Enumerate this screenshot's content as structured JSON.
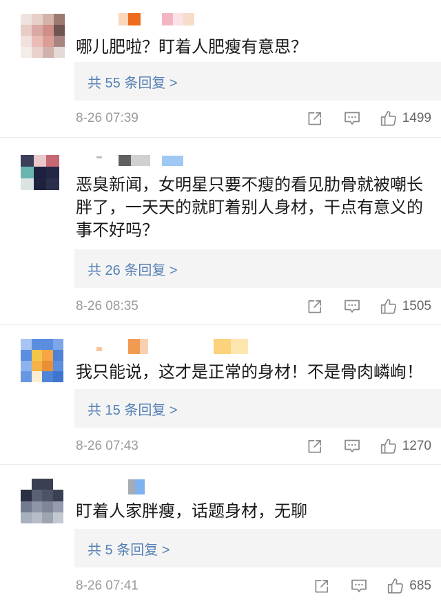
{
  "comments": [
    {
      "avatar_colors": [
        [
          "#efe3df",
          "#e6d0c9",
          "#d4b3aa",
          "#9d7a70"
        ],
        [
          "#e7cdc5",
          "#d9aaa3",
          "#cf8f88",
          "#6f5650"
        ],
        [
          "#f1e0dc",
          "#e9bcb6",
          "#dd9d97",
          "#a78680"
        ],
        [
          "#f4ece9",
          "#e9d2cc",
          "#d1b1ab",
          "#e3dad7"
        ]
      ],
      "text": "哪儿肥啦？盯着人肥瘦有意思？",
      "replies_label": "共 55 条回复 >",
      "time": "8-26 07:39",
      "likes": "1499"
    },
    {
      "avatar_colors": [
        [
          "#3b3f5a",
          "#e9c9cc",
          "#c76774"
        ],
        [
          "#6bb5b0",
          "#1c2140",
          "#222743"
        ],
        [
          "#dbe3e3",
          "#1e223d",
          "#2b2f4c"
        ]
      ],
      "text": "恶臭新闻，女明星只要不瘦的看见肋骨就被嘲长胖了，一天天的就盯着别人身材，干点有意义的事不好吗？",
      "replies_label": "共 26 条回复 >",
      "time": "8-26 08:35",
      "likes": "1505"
    },
    {
      "avatar_colors": [
        [
          "#a9c4f0",
          "#5b8ee0",
          "#5a8ddf",
          "#7da6ea"
        ],
        [
          "#5b8ee0",
          "#f2c64a",
          "#f7a545",
          "#4f82d6"
        ],
        [
          "#8db3ef",
          "#f6b24a",
          "#e98f35",
          "#5d8fdf"
        ],
        [
          "#6897e2",
          "#fbeed0",
          "#4f84d8",
          "#3f75cc"
        ]
      ],
      "text": "我只能说，这才是正常的身材！不是骨肉嶙峋！",
      "replies_label": "共 15 条回复 >",
      "time": "8-26 07:43",
      "likes": "1270"
    },
    {
      "avatar_colors": [
        [
          "#ffffff",
          "#3a3f52",
          "#3a3f52",
          "#ffffff"
        ],
        [
          "#2a2f43",
          "#5a6175",
          "#4c5366",
          "#3a4054"
        ],
        [
          "#737b8e",
          "#8d95a6",
          "#7e8698",
          "#949cad"
        ],
        [
          "#a9b0bd",
          "#b7bdc8",
          "#9da4b2",
          "#c3c8d1"
        ]
      ],
      "text": "盯着人家胖瘦，话题身材，无聊",
      "replies_label": "共 5 条回复 >",
      "time": "8-26 07:41",
      "likes": "685"
    }
  ],
  "icons": {
    "share": "share-icon",
    "comment": "comment-icon",
    "like": "thumbs-up-icon"
  },
  "colors": {
    "text": "#1a1a1a",
    "link": "#5680b5",
    "meta": "#9a9a9a",
    "reply_bg": "#f4f4f4",
    "icon": "#8c8c8c",
    "count": "#666666"
  }
}
